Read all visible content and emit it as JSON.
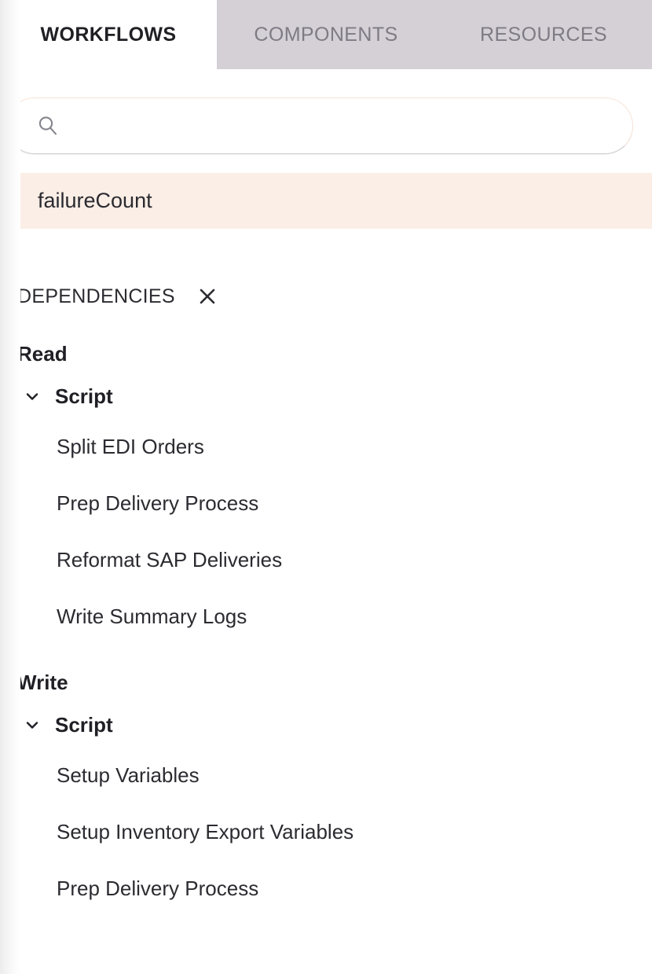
{
  "tabs": [
    {
      "label": "WORKFLOWS",
      "active": true
    },
    {
      "label": "COMPONENTS",
      "active": false
    },
    {
      "label": "RESOURCES",
      "active": false
    }
  ],
  "search": {
    "value": "",
    "placeholder": "",
    "icon": "search-icon"
  },
  "selected_result": {
    "label": "failureCount"
  },
  "dependencies": {
    "title": "DEPENDENCIES",
    "close_icon": "close-icon",
    "groups": [
      {
        "title": "Read",
        "nodes": [
          {
            "label": "Script",
            "expanded": true,
            "chevron_icon": "chevron-down-icon",
            "items": [
              "Split EDI Orders",
              "Prep Delivery Process",
              "Reformat SAP Deliveries",
              "Write Summary Logs"
            ]
          }
        ]
      },
      {
        "title": "Write",
        "nodes": [
          {
            "label": "Script",
            "expanded": true,
            "chevron_icon": "chevron-down-icon",
            "items": [
              "Setup Variables",
              "Setup Inventory Export Variables",
              "Prep Delivery Process"
            ]
          }
        ]
      }
    ]
  },
  "colors": {
    "tab_inactive_bg": "#d4d0d6",
    "tab_inactive_text": "#7e7b84",
    "tab_active_text": "#1f1f24",
    "highlight_row_bg": "#fbeee6",
    "search_border": "#f6e3d7",
    "text_primary": "#2b2b31"
  }
}
